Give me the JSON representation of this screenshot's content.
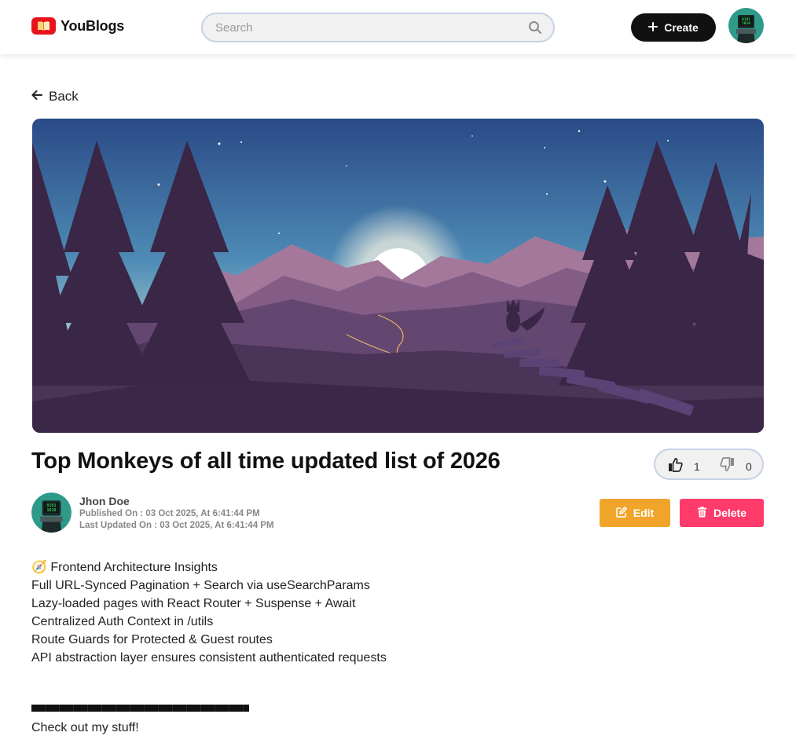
{
  "header": {
    "brand": "YouBlogs",
    "search_placeholder": "Search",
    "create_label": "Create"
  },
  "nav": {
    "back_label": "Back"
  },
  "post": {
    "title": "Top Monkeys of all time updated list of 2026",
    "likes": "1",
    "dislikes": "0",
    "author": "Jhon Doe",
    "published": "Published On : 03 Oct 2025, At 6:41:44 PM",
    "updated": "Last Updated On : 03 Oct 2025, At 6:41:44 PM",
    "edit_label": "Edit",
    "delete_label": "Delete",
    "body_lines": [
      "🧭 Frontend Architecture Insights",
      "Full URL-Synced Pagination + Search via useSearchParams",
      "Lazy-loaded pages with React Router + Suspense + Await",
      "Centralized Auth Context in /utils",
      "Route Guards for Protected & Guest routes",
      "API abstraction layer ensures consistent authenticated requests"
    ],
    "footer_text": "Check out my stuff!"
  },
  "colors": {
    "brand_red": "#e8141c",
    "edit": "#f0a52a",
    "delete": "#ff3b6b",
    "create": "#111111"
  }
}
